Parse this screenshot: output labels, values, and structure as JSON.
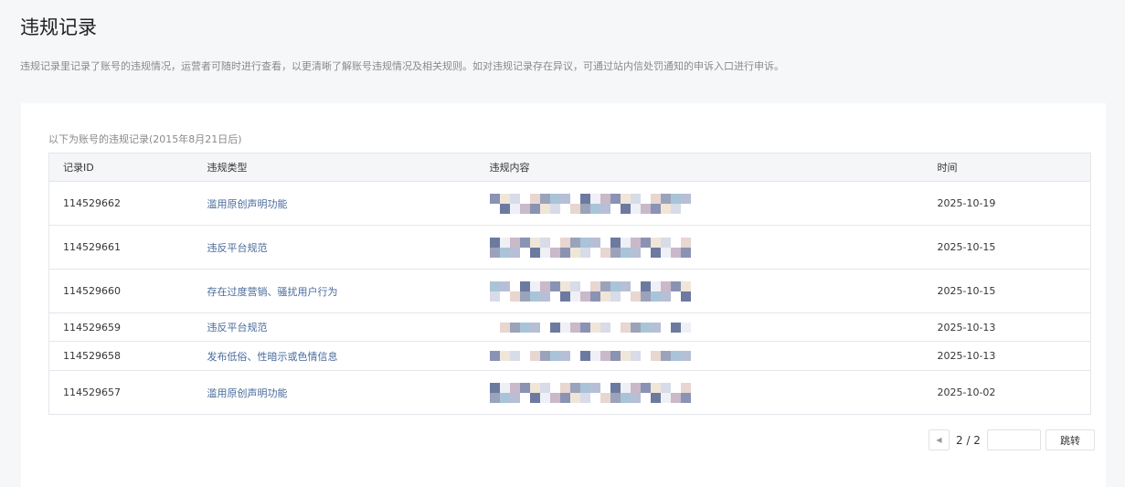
{
  "page": {
    "title": "违规记录",
    "description": "违规记录里记录了账号的违规情况，运营者可随时进行查看，以更清晰了解账号违规情况及相关规则。如对违规记录存在异议，可通过站内信处罚通知的申诉入口进行申诉。"
  },
  "records": {
    "subtitle": "以下为账号的违规记录(2015年8月21日后)",
    "headers": [
      "记录ID",
      "违规类型",
      "违规内容",
      "时间"
    ],
    "rows": [
      {
        "id": "114529662",
        "type": "滥用原创声明功能",
        "time": "2025-10-19"
      },
      {
        "id": "114529661",
        "type": "违反平台规范",
        "time": "2025-10-15"
      },
      {
        "id": "114529660",
        "type": "存在过度营销、骚扰用户行为",
        "time": "2025-10-15"
      },
      {
        "id": "114529659",
        "type": "违反平台规范",
        "time": "2025-10-13"
      },
      {
        "id": "114529658",
        "type": "发布低俗、性暗示或色情信息",
        "time": "2025-10-13"
      },
      {
        "id": "114529657",
        "type": "滥用原创声明功能",
        "time": "2025-10-02"
      }
    ]
  },
  "pagination": {
    "current": "2 / 2",
    "jump_label": "跳转",
    "jump_value": ""
  }
}
